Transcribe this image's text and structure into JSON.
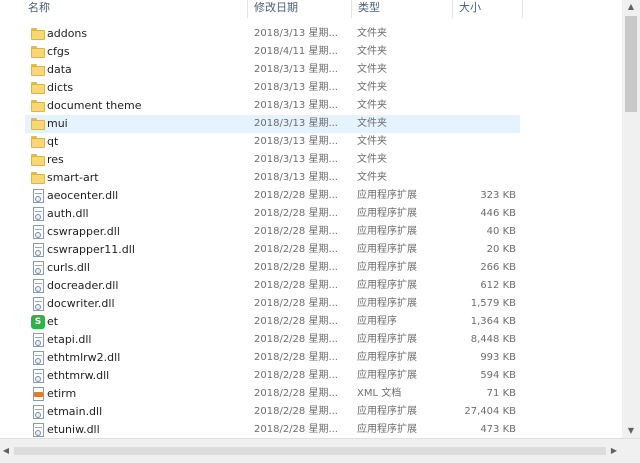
{
  "columns": {
    "name": "名称",
    "date": "修改日期",
    "type": "类型",
    "size": "大小"
  },
  "files": [
    {
      "name": "addons",
      "date": "2018/3/13 星期...",
      "type": "文件夹",
      "size": "",
      "icon": "folder-icon",
      "selected": false
    },
    {
      "name": "cfgs",
      "date": "2018/4/11 星期...",
      "type": "文件夹",
      "size": "",
      "icon": "folder-icon",
      "selected": false
    },
    {
      "name": "data",
      "date": "2018/3/13 星期...",
      "type": "文件夹",
      "size": "",
      "icon": "folder-icon",
      "selected": false
    },
    {
      "name": "dicts",
      "date": "2018/3/13 星期...",
      "type": "文件夹",
      "size": "",
      "icon": "folder-icon",
      "selected": false
    },
    {
      "name": "document theme",
      "date": "2018/3/13 星期...",
      "type": "文件夹",
      "size": "",
      "icon": "folder-icon",
      "selected": false
    },
    {
      "name": "mui",
      "date": "2018/3/13 星期...",
      "type": "文件夹",
      "size": "",
      "icon": "folder-icon",
      "selected": true
    },
    {
      "name": "qt",
      "date": "2018/3/13 星期...",
      "type": "文件夹",
      "size": "",
      "icon": "folder-icon",
      "selected": false
    },
    {
      "name": "res",
      "date": "2018/3/13 星期...",
      "type": "文件夹",
      "size": "",
      "icon": "folder-icon",
      "selected": false
    },
    {
      "name": "smart-art",
      "date": "2018/3/13 星期...",
      "type": "文件夹",
      "size": "",
      "icon": "folder-icon",
      "selected": false
    },
    {
      "name": "aeocenter.dll",
      "date": "2018/2/28 星期...",
      "type": "应用程序扩展",
      "size": "323 KB",
      "icon": "dll-file-icon",
      "selected": false
    },
    {
      "name": "auth.dll",
      "date": "2018/2/28 星期...",
      "type": "应用程序扩展",
      "size": "446 KB",
      "icon": "dll-file-icon",
      "selected": false
    },
    {
      "name": "cswrapper.dll",
      "date": "2018/2/28 星期...",
      "type": "应用程序扩展",
      "size": "40 KB",
      "icon": "dll-file-icon",
      "selected": false
    },
    {
      "name": "cswrapper11.dll",
      "date": "2018/2/28 星期...",
      "type": "应用程序扩展",
      "size": "20 KB",
      "icon": "dll-file-icon",
      "selected": false
    },
    {
      "name": "curls.dll",
      "date": "2018/2/28 星期...",
      "type": "应用程序扩展",
      "size": "266 KB",
      "icon": "dll-file-icon",
      "selected": false
    },
    {
      "name": "docreader.dll",
      "date": "2018/2/28 星期...",
      "type": "应用程序扩展",
      "size": "612 KB",
      "icon": "dll-file-icon",
      "selected": false
    },
    {
      "name": "docwriter.dll",
      "date": "2018/2/28 星期...",
      "type": "应用程序扩展",
      "size": "1,579 KB",
      "icon": "dll-file-icon",
      "selected": false
    },
    {
      "name": "et",
      "date": "2018/2/28 星期...",
      "type": "应用程序",
      "size": "1,364 KB",
      "icon": "app-icon",
      "selected": false
    },
    {
      "name": "etapi.dll",
      "date": "2018/2/28 星期...",
      "type": "应用程序扩展",
      "size": "8,448 KB",
      "icon": "dll-file-icon",
      "selected": false
    },
    {
      "name": "ethtmlrw2.dll",
      "date": "2018/2/28 星期...",
      "type": "应用程序扩展",
      "size": "993 KB",
      "icon": "dll-file-icon",
      "selected": false
    },
    {
      "name": "ethtmrw.dll",
      "date": "2018/2/28 星期...",
      "type": "应用程序扩展",
      "size": "594 KB",
      "icon": "dll-file-icon",
      "selected": false
    },
    {
      "name": "etirm",
      "date": "2018/2/28 星期...",
      "type": "XML 文档",
      "size": "71 KB",
      "icon": "xml-file-icon",
      "selected": false
    },
    {
      "name": "etmain.dll",
      "date": "2018/2/28 星期...",
      "type": "应用程序扩展",
      "size": "27,404 KB",
      "icon": "dll-file-icon",
      "selected": false
    },
    {
      "name": "etuniw.dll",
      "date": "2018/2/28 星期...",
      "type": "应用程序扩展",
      "size": "473 KB",
      "icon": "dll-file-icon",
      "selected": false
    }
  ],
  "icons": {
    "scroll_up": "▲",
    "scroll_down": "▼",
    "scroll_left": "◀",
    "scroll_right": "▶",
    "app_badge": "S"
  },
  "colors": {
    "selection": "#e5f3ff",
    "folder": "#f8d775",
    "app_icon": "#2fb24c"
  }
}
